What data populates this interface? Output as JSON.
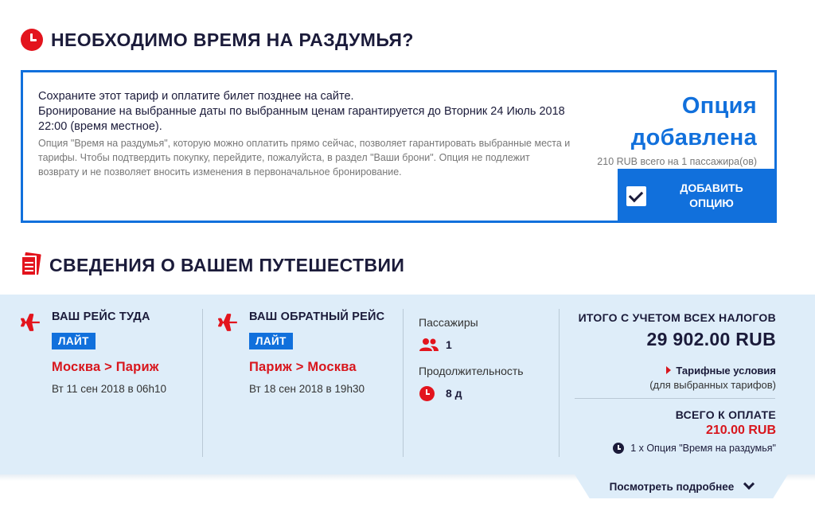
{
  "think_section": {
    "title": "НЕОБХОДИМО ВРЕМЯ НА РАЗДУМЬЯ?",
    "line1": "Сохраните этот тариф и оплатите билет позднее на сайте.",
    "line2": "Бронирование на выбранные даты по выбранным ценам гарантируется до Вторник 24 Июль 2018 22:00 (время местное).",
    "description": "Опция \"Время на раздумья\", которую можно оплатить прямо сейчас, позволяет гарантировать выбранные места и тарифы. Чтобы подтвердить покупку, перейдите, пожалуйста, в раздел \"Ваши брони\". Опция не подлежит возврату и не позволяет вносить изменения в первоначальное бронирование.",
    "status_line1": "Опция",
    "status_line2": "добавлена",
    "price_note": "210 RUB всего на 1 пассажира(ов)",
    "add_button": "ДОБАВИТЬ ОПЦИЮ",
    "accent_color": "#1170dc",
    "icon": "clock-icon"
  },
  "trip_section": {
    "title": "СВЕДЕНИЯ О ВАШЕМ ПУТЕШЕСТВИИ",
    "icon": "documents-icon",
    "outbound": {
      "title": "ВАШ РЕЙС ТУДА",
      "fare": "ЛАЙТ",
      "route": "Москва > Париж",
      "date": "Вт 11 сен 2018 в 06h10"
    },
    "return": {
      "title": "ВАШ ОБРАТНЫЙ РЕЙС",
      "fare": "ЛАЙТ",
      "route": "Париж > Москва",
      "date": "Вт 18 сен 2018 в 19h30"
    },
    "passengers_label": "Пассажиры",
    "passengers_value": "1",
    "duration_label": "Продолжительность",
    "duration_value": "8 д",
    "total_label": "ИТОГО С УЧЕТОМ ВСЕХ НАЛОГОВ",
    "total_amount": "29 902.00 RUB",
    "fare_conditions_link": "Тарифные условия",
    "fare_conditions_sub": "(для выбранных тарифов)",
    "pay_label": "ВСЕГО К ОПЛАТЕ",
    "pay_amount": "210.00 RUB",
    "pay_item": "1 x Опция \"Время на раздумья\"",
    "more_link": "Посмотреть подробнее",
    "red_color": "#d8161d",
    "panel_color": "#deedf9"
  }
}
